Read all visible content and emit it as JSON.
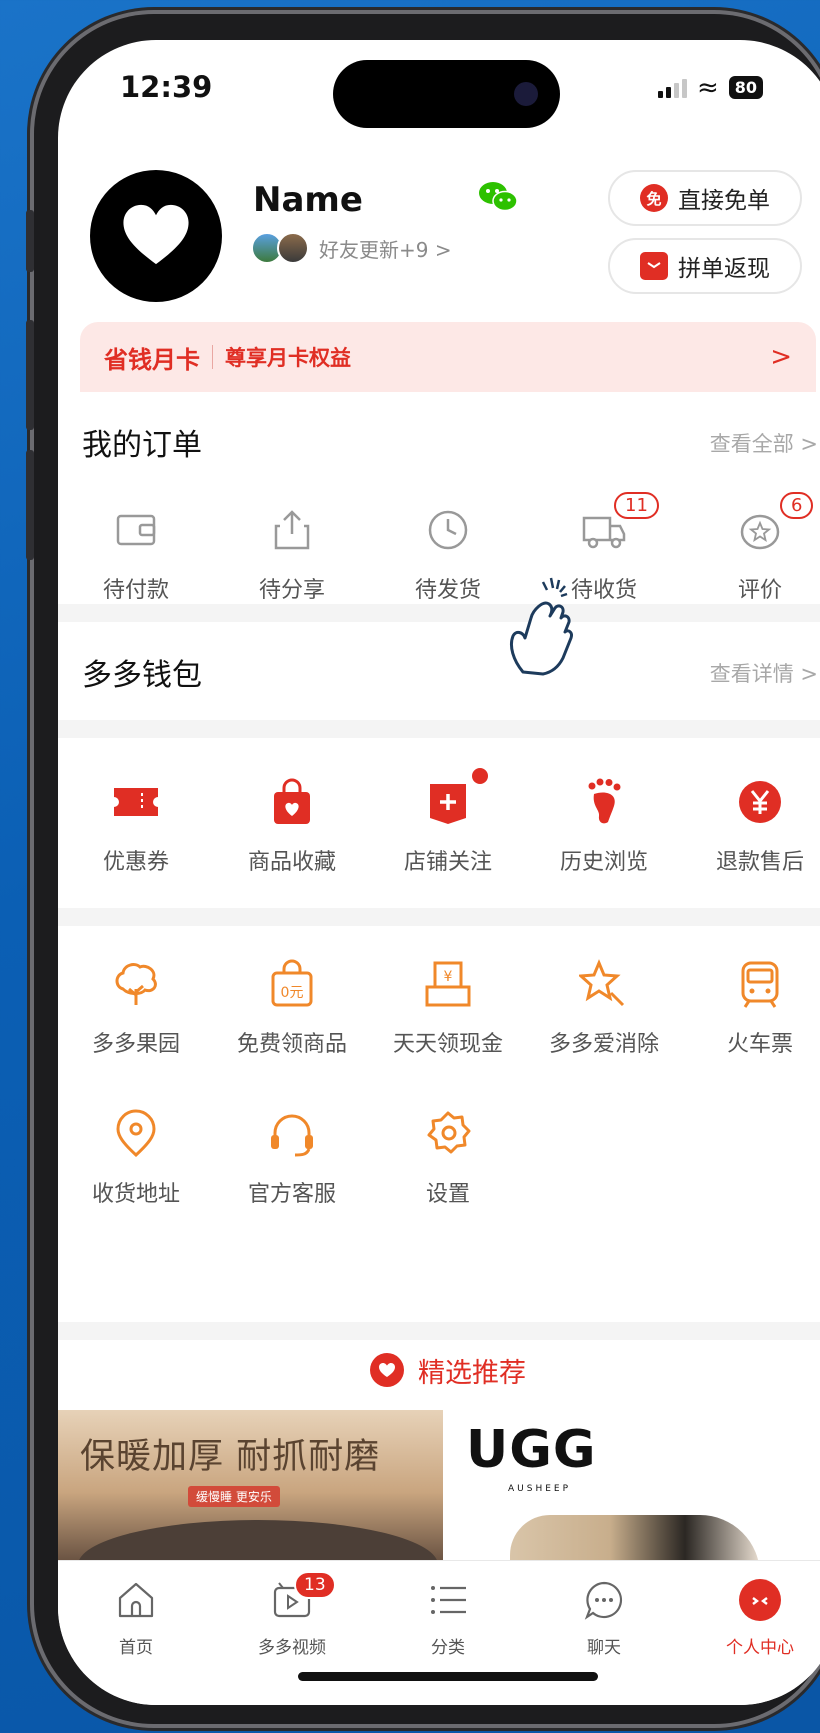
{
  "status_bar": {
    "time": "12:39",
    "battery": "80"
  },
  "profile": {
    "name": "Name",
    "friends_text": "好友更新+9 >",
    "buttons": [
      {
        "icon": "免",
        "label": "直接免单"
      },
      {
        "icon": "",
        "label": "拼单返现"
      }
    ]
  },
  "month_card": {
    "title": "省钱月卡",
    "subtitle": "尊享月卡权益",
    "arrow": ">"
  },
  "orders": {
    "title": "我的订单",
    "link": "查看全部 >",
    "items": [
      {
        "label": "待付款",
        "icon": "wallet-icon"
      },
      {
        "label": "待分享",
        "icon": "share-icon"
      },
      {
        "label": "待发货",
        "icon": "clock-icon"
      },
      {
        "label": "待收货",
        "icon": "truck-icon",
        "badge": "11"
      },
      {
        "label": "评价",
        "icon": "review-icon",
        "badge": "6"
      }
    ]
  },
  "wallet": {
    "title": "多多钱包",
    "link": "查看详情 >"
  },
  "services": [
    {
      "label": "优惠券",
      "icon": "coupon-icon"
    },
    {
      "label": "商品收藏",
      "icon": "bag-icon"
    },
    {
      "label": "店铺关注",
      "icon": "store-icon"
    },
    {
      "label": "历史浏览",
      "icon": "footprint-icon"
    },
    {
      "label": "退款售后",
      "icon": "refund-icon"
    }
  ],
  "tools": [
    {
      "label": "多多果园",
      "icon": "tree-icon"
    },
    {
      "label": "免费领商品",
      "icon": "free-item-icon",
      "glyph": "0元"
    },
    {
      "label": "天天领现金",
      "icon": "cash-icon",
      "glyph": "¥"
    },
    {
      "label": "多多爱消除",
      "icon": "star-icon"
    },
    {
      "label": "火车票",
      "icon": "train-icon"
    },
    {
      "label": "收货地址",
      "icon": "location-icon"
    },
    {
      "label": "官方客服",
      "icon": "headset-icon"
    },
    {
      "label": "设置",
      "icon": "settings-icon"
    }
  ],
  "recommend": {
    "title": "精选推荐"
  },
  "products": [
    {
      "title": "保暖加厚 耐抓耐磨",
      "tag": "缓慢睡 更安乐"
    },
    {
      "brand": "UGG",
      "brand_sub": "AUSHEEP"
    }
  ],
  "tabbar": [
    {
      "label": "首页",
      "icon": "home-icon"
    },
    {
      "label": "多多视频",
      "icon": "video-icon",
      "badge": "13"
    },
    {
      "label": "分类",
      "icon": "list-icon"
    },
    {
      "label": "聊天",
      "icon": "chat-icon"
    },
    {
      "label": "个人中心",
      "icon": "profile-icon",
      "active": true
    }
  ],
  "colors": {
    "accent": "#e02e24",
    "tool_orange": "#f0882a",
    "background": "#0b5fb4"
  }
}
